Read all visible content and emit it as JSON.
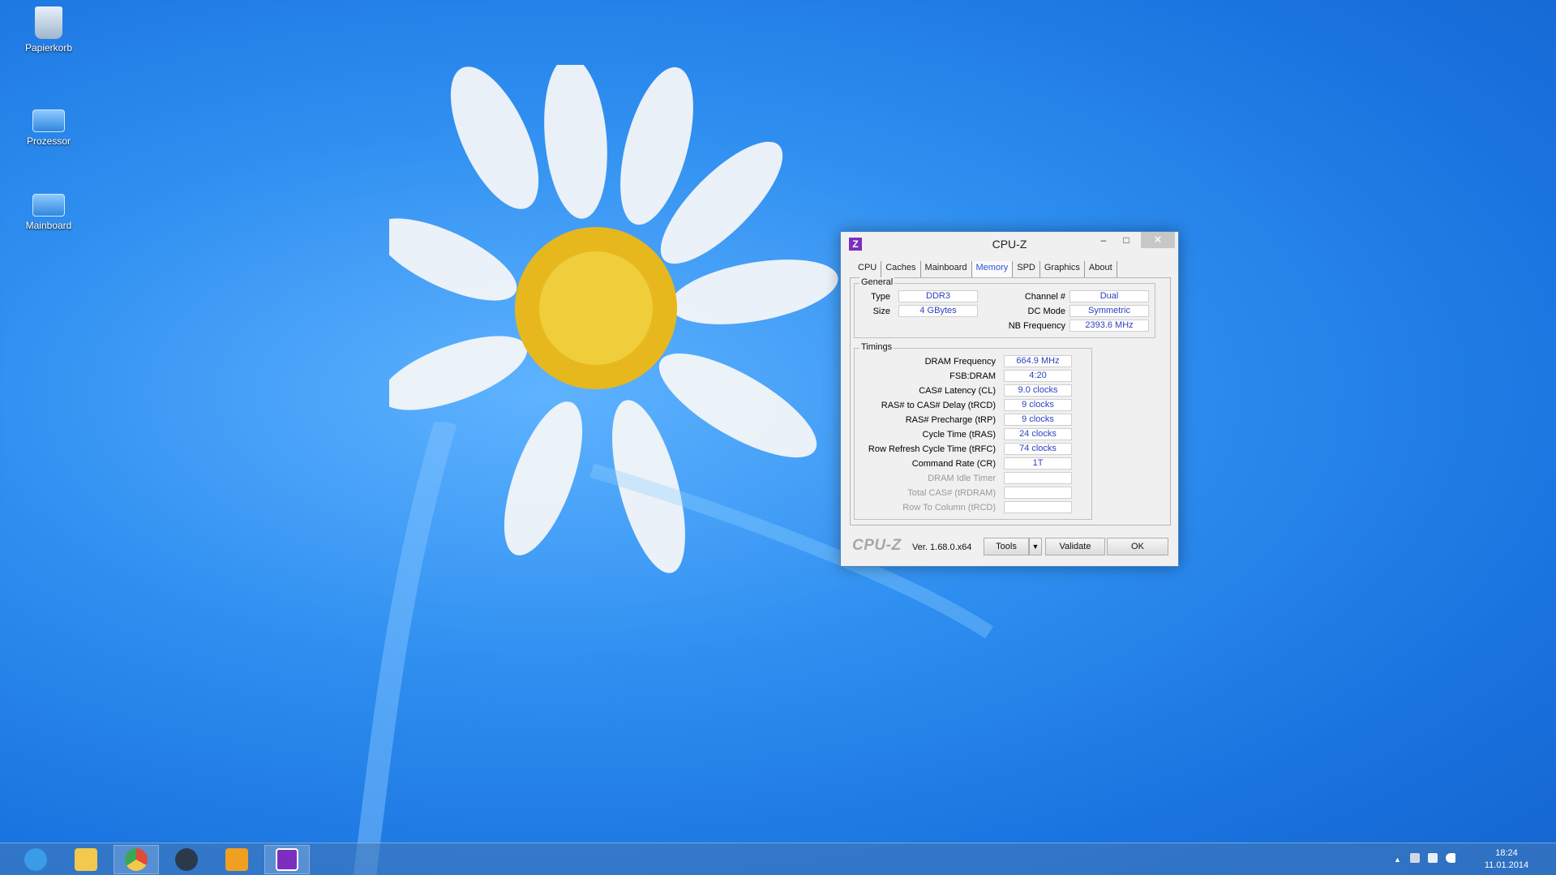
{
  "desktop": {
    "icons": [
      {
        "label": "Papierkorb"
      },
      {
        "label": "Prozessor"
      },
      {
        "label": "Mainboard"
      }
    ]
  },
  "window": {
    "title": "CPU-Z",
    "logo_char": "Z",
    "controls": {
      "minimize": "–",
      "maximize": "□",
      "close": "✕"
    },
    "tabs": [
      "CPU",
      "Caches",
      "Mainboard",
      "Memory",
      "SPD",
      "Graphics",
      "About"
    ],
    "active_tab": "Memory",
    "general": {
      "legend": "General",
      "type_label": "Type",
      "type_value": "DDR3",
      "size_label": "Size",
      "size_value": "4 GBytes",
      "channel_label": "Channel #",
      "channel_value": "Dual",
      "dcmode_label": "DC Mode",
      "dcmode_value": "Symmetric",
      "nbfreq_label": "NB Frequency",
      "nbfreq_value": "2393.6 MHz"
    },
    "timings": {
      "legend": "Timings",
      "rows": [
        {
          "label": "DRAM Frequency",
          "value": "664.9 MHz",
          "dim": false
        },
        {
          "label": "FSB:DRAM",
          "value": "4:20",
          "dim": false
        },
        {
          "label": "CAS# Latency (CL)",
          "value": "9.0 clocks",
          "dim": false
        },
        {
          "label": "RAS# to CAS# Delay (tRCD)",
          "value": "9 clocks",
          "dim": false
        },
        {
          "label": "RAS# Precharge (tRP)",
          "value": "9 clocks",
          "dim": false
        },
        {
          "label": "Cycle Time (tRAS)",
          "value": "24 clocks",
          "dim": false
        },
        {
          "label": "Row Refresh Cycle Time (tRFC)",
          "value": "74 clocks",
          "dim": false
        },
        {
          "label": "Command Rate (CR)",
          "value": "1T",
          "dim": false
        },
        {
          "label": "DRAM Idle Timer",
          "value": "",
          "dim": true
        },
        {
          "label": "Total CAS# (tRDRAM)",
          "value": "",
          "dim": true
        },
        {
          "label": "Row To Column (tRCD)",
          "value": "",
          "dim": true
        }
      ]
    },
    "footer": {
      "brand": "CPU-Z",
      "version": "Ver. 1.68.0.x64",
      "tools": "Tools",
      "tools_arrow": "▼",
      "validate": "Validate",
      "ok": "OK"
    }
  },
  "taskbar": {
    "apps": [
      {
        "name": "internet-explorer",
        "color": "#3a9be8"
      },
      {
        "name": "file-explorer",
        "color": "#f2c94c"
      },
      {
        "name": "chrome",
        "color": "#e04a3a"
      },
      {
        "name": "steam",
        "color": "#2b3a4a"
      },
      {
        "name": "tools-app",
        "color": "#f0a020"
      },
      {
        "name": "cpu-z",
        "color": "#7b2fbf"
      }
    ],
    "tray": {
      "chevron": "▲",
      "time": "18:24",
      "date": "11.01.2014"
    }
  }
}
